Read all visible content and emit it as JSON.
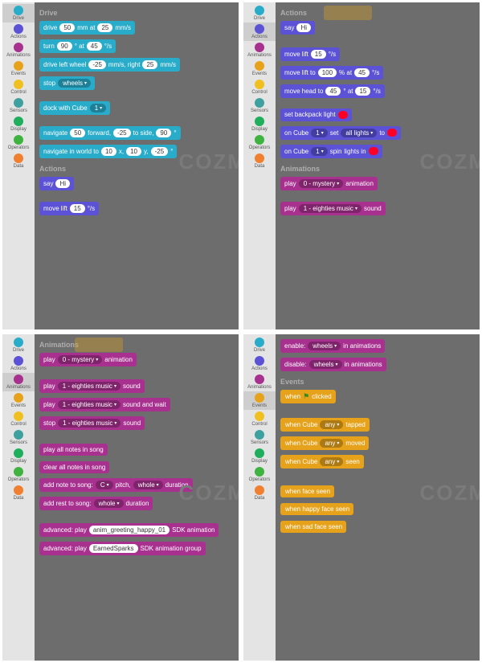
{
  "watermark": "COZM",
  "categories": [
    {
      "name": "Drive",
      "color": "#29abca"
    },
    {
      "name": "Actions",
      "color": "#5b52d6"
    },
    {
      "name": "Animations",
      "color": "#a8318f"
    },
    {
      "name": "Events",
      "color": "#e6a21a"
    },
    {
      "name": "Control",
      "color": "#f0c020"
    },
    {
      "name": "Sensors",
      "color": "#3fa0a0"
    },
    {
      "name": "Display",
      "color": "#1fae5c"
    },
    {
      "name": "Operators",
      "color": "#3fb33f"
    },
    {
      "name": "Data",
      "color": "#f08030"
    }
  ],
  "q1": {
    "sec1": "Drive",
    "drive1_a": "drive",
    "drive1_v1": "50",
    "drive1_b": "mm at",
    "drive1_v2": "25",
    "drive1_c": "mm/s",
    "turn_a": "turn",
    "turn_v1": "90",
    "turn_b": "° at",
    "turn_v2": "45",
    "turn_c": "°/s",
    "dlw_a": "drive left wheel",
    "dlw_v1": "-25",
    "dlw_b": "mm/s, right",
    "dlw_v2": "25",
    "dlw_c": "mm/s",
    "stop_a": "stop",
    "stop_dd": "wheels",
    "dock_a": "dock with Cube",
    "dock_dd": "1",
    "nav_a": "navigate",
    "nav_v1": "50",
    "nav_b": "forward,",
    "nav_v2": "-25",
    "nav_c": "to side,",
    "nav_v3": "90",
    "nav_d": "°",
    "navw_a": "navigate in world to",
    "navw_v1": "10",
    "navw_b": "x,",
    "navw_v2": "10",
    "navw_c": "y,",
    "navw_v3": "-25",
    "navw_d": "°",
    "sec2": "Actions",
    "say_a": "say",
    "say_v": "Hi",
    "ml_a": "move lift",
    "ml_v": "15",
    "ml_b": "°/s"
  },
  "q2": {
    "sec1": "Actions",
    "say_a": "say",
    "say_v": "Hi",
    "ml_a": "move lift",
    "ml_v": "15",
    "ml_b": "°/s",
    "mlt_a": "move lift to",
    "mlt_v1": "100",
    "mlt_b": "% at",
    "mlt_v2": "45",
    "mlt_c": "°/s",
    "mh_a": "move head to",
    "mh_v1": "45",
    "mh_b": "° at",
    "mh_v2": "15",
    "mh_c": "°/s",
    "sbp": "set backpack light",
    "oc_a": "on Cube",
    "oc_dd1": "1",
    "oc_b": "set",
    "oc_dd2": "all lights",
    "oc_c": "to",
    "oc2_a": "on Cube",
    "oc2_dd1": "1",
    "oc2_b": "spin",
    "oc2_c": "lights in",
    "sec2": "Animations",
    "pa_a": "play",
    "pa_dd": "0 - mystery",
    "pa_b": "animation",
    "ps_a": "play",
    "ps_dd": "1 - eighties music",
    "ps_b": "sound"
  },
  "q3": {
    "sec": "Animations",
    "pa_a": "play",
    "pa_dd": "0 - mystery",
    "pa_b": "animation",
    "ps_a": "play",
    "ps_dd": "1 - eighties music",
    "ps_b": "sound",
    "psw_a": "play",
    "psw_dd": "1 - eighties music",
    "psw_b": "sound and wait",
    "ss_a": "stop",
    "ss_dd": "1 - eighties music",
    "ss_b": "sound",
    "pan": "play all notes in song",
    "can": "clear all notes in song",
    "ans_a": "add note to song:",
    "ans_dd1": "C",
    "ans_b": "pitch,",
    "ans_dd2": "whole",
    "ans_c": "duration",
    "ars_a": "add rest to song:",
    "ars_dd": "whole",
    "ars_b": "duration",
    "adv1_a": "advanced: play",
    "adv1_v": "anim_greeting_happy_01",
    "adv1_b": "SDK animation",
    "adv2_a": "advanced: play",
    "adv2_v": "EarnedSparks",
    "adv2_b": "SDK animation group"
  },
  "q4": {
    "en_a": "enable:",
    "en_dd": "wheels",
    "en_b": "in animations",
    "di_a": "disable:",
    "di_dd": "wheels",
    "di_b": "in animations",
    "sec": "Events",
    "wfc_a": "when",
    "wfc_b": "clicked",
    "wct_a": "when Cube",
    "wct_dd": "any",
    "wct_b": "tapped",
    "wcm_a": "when Cube",
    "wcm_dd": "any",
    "wcm_b": "moved",
    "wcs_a": "when Cube",
    "wcs_dd": "any",
    "wcs_b": "seen",
    "wfs": "when face seen",
    "whfs": "when happy face seen",
    "wsfs": "when sad face seen"
  }
}
